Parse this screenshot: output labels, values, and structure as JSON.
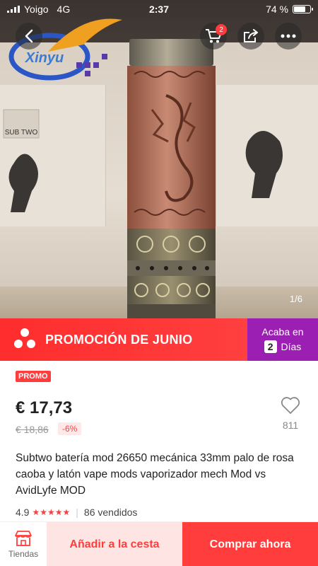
{
  "status_bar": {
    "carrier": "Yoigo",
    "network": "4G",
    "time": "2:37",
    "battery_percent": "74 %",
    "battery_level": 0.74
  },
  "product_image": {
    "counter": "1/6",
    "watermark_text": "Xinyu",
    "box_label": "SUB TWO"
  },
  "nav": {
    "cart_badge": "2",
    "icons": [
      "back-chevron-icon",
      "cart-icon",
      "share-icon",
      "more-icon"
    ]
  },
  "promo_banner": {
    "title": "PROMOCIÓN DE JUNIO",
    "countdown_label": "Acaba en",
    "countdown_value": "2",
    "countdown_unit": "Días",
    "colors": {
      "banner": "#ff3d3d",
      "countdown_bg": "#9b1fb2"
    }
  },
  "product": {
    "promo_tag": "PROMO",
    "price": "€ 17,73",
    "old_price": "€ 18,86",
    "discount": "-6%",
    "wishlist_count": "811",
    "title": "Subtwo batería mod 26650 mecánica 33mm palo de rosa caoba y latón vape mods vaporizador mech Mod vs AvidLyfe MOD",
    "rating": "4.9",
    "stars": "★★★★★",
    "sold": "86 vendidos"
  },
  "bottom_bar": {
    "store_label": "Tiendas",
    "add_to_cart": "Añadir a la cesta",
    "buy_now": "Comprar ahora",
    "colors": {
      "accent": "#ff3d3d",
      "cart_bg": "#ffe4e4"
    }
  }
}
